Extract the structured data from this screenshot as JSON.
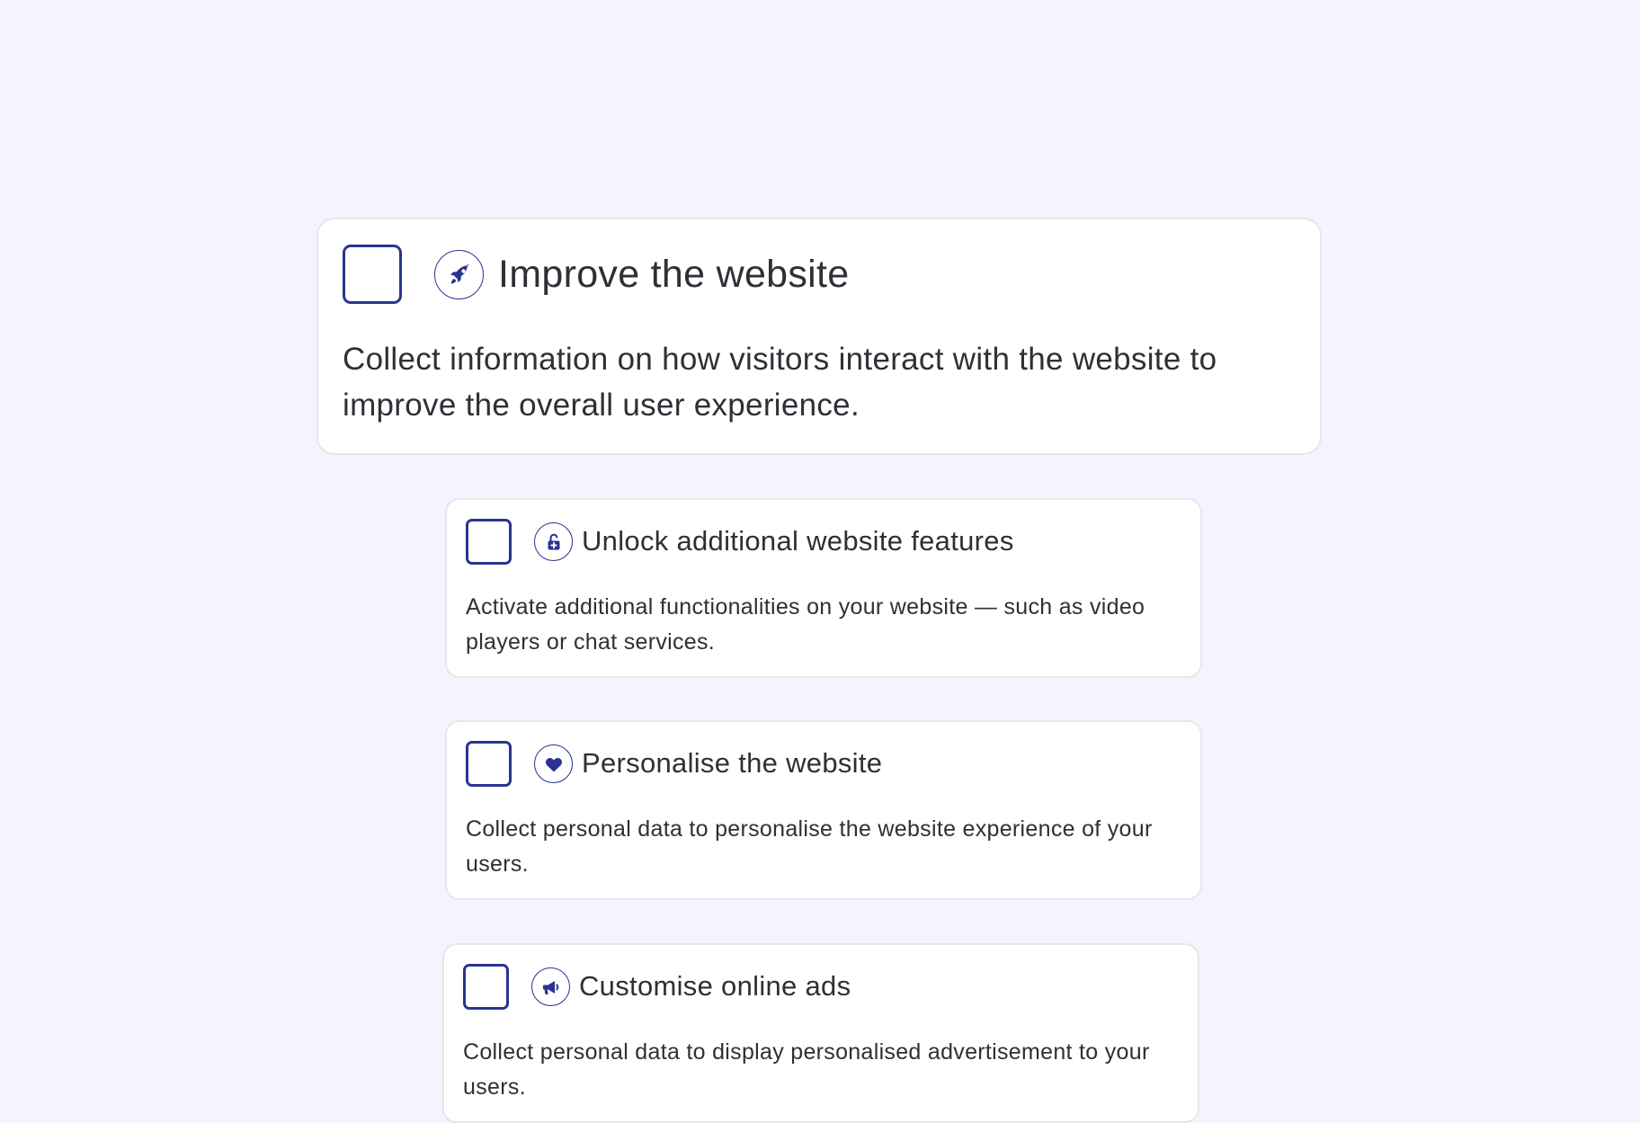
{
  "options": [
    {
      "title": "Improve the website",
      "description": "Collect information on how visitors interact with the website to improve the overall user experience.",
      "icon": "rocket-icon",
      "checked": false
    },
    {
      "title": "Unlock additional website features",
      "description": "Activate additional functionalities on your website — such as video players or chat services.",
      "icon": "unlock-icon",
      "checked": false
    },
    {
      "title": "Personalise the website",
      "description": "Collect personal data to personalise the website experience of your users.",
      "icon": "heart-icon",
      "checked": false
    },
    {
      "title": "Customise online ads",
      "description": "Collect personal data to display personalised advertisement to your users.",
      "icon": "megaphone-icon",
      "checked": false
    }
  ],
  "colors": {
    "background": "#f3f4fe",
    "card": "#ffffff",
    "card_border": "#e6e6ec",
    "accent": "#2a3391",
    "text": "#2f2f36"
  }
}
